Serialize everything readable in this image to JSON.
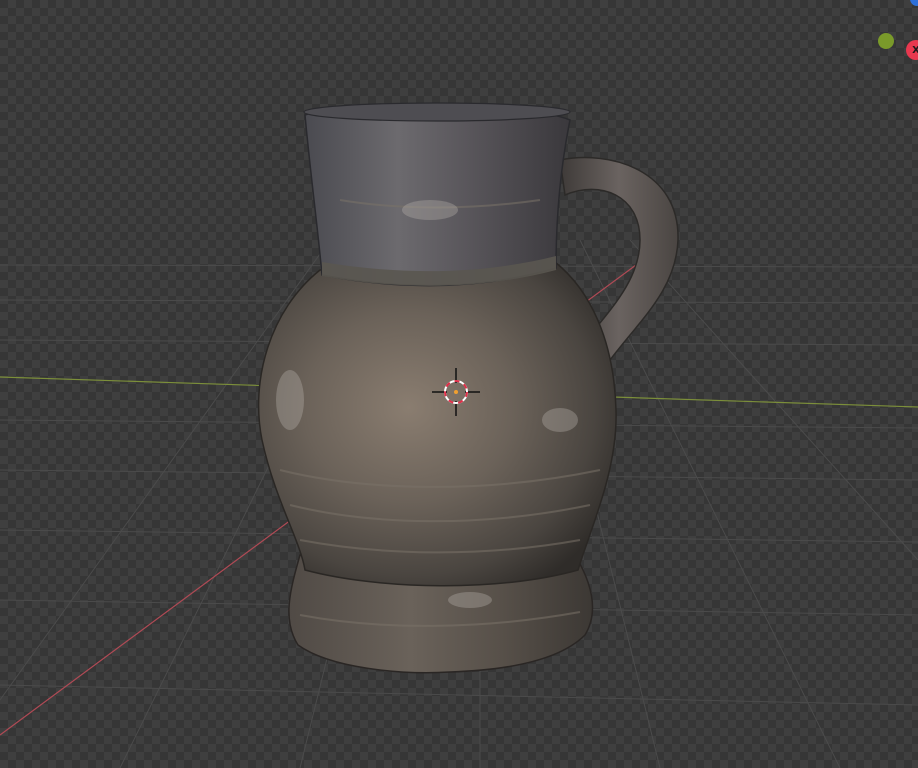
{
  "viewport": {
    "background": "#3a3a3a",
    "grid_color": "#4a4a4a",
    "x_axis_color": "#b04a55",
    "y_axis_color": "#7c8f3a"
  },
  "gizmo": {
    "x_label": "X",
    "x_color": "#e8384f",
    "y_color": "#7a9a2a",
    "z_color": "#2e6fd8"
  },
  "object": {
    "name_icon": "jug-mesh-icon",
    "cursor_icon": "3d-cursor-icon"
  }
}
